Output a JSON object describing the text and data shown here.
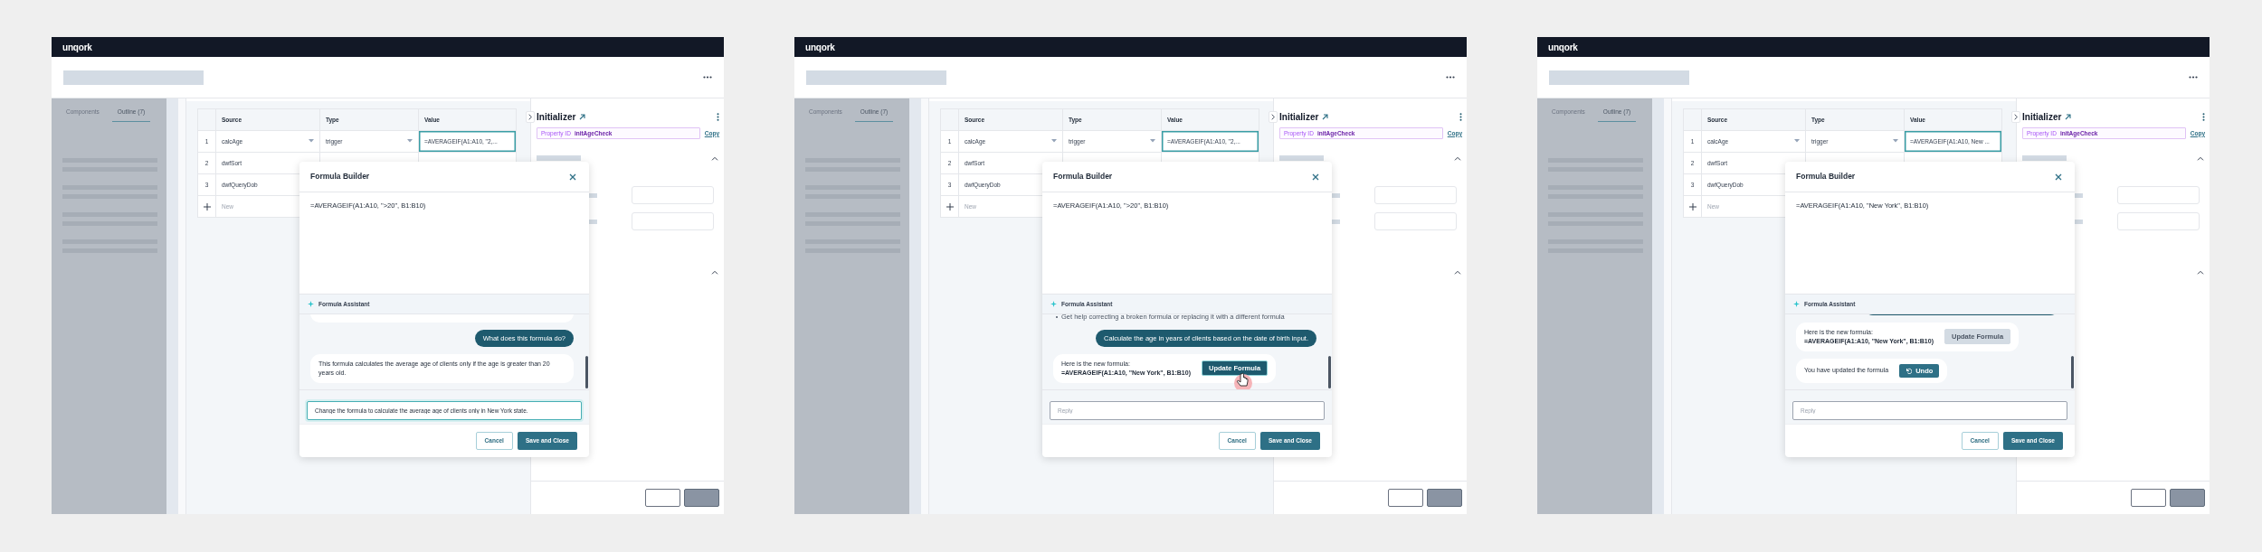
{
  "screens": [
    {
      "logo": "unqork",
      "sidebar_tabs": [
        {
          "label": "Components",
          "selected": false
        },
        {
          "label": "Outline (7)",
          "selected": true
        }
      ],
      "table": {
        "columns": [
          "Source",
          "Type",
          "Value"
        ],
        "rows": [
          {
            "number": "1",
            "source": "calcAge",
            "type": "trigger",
            "value": "=AVERAGEIF(A1:A10, \"2,...",
            "selected": true
          },
          {
            "number": "2",
            "source": "dwfSort",
            "selected": false
          },
          {
            "number": "3",
            "source": "dwfQueryDob"
          }
        ],
        "new_row": "New"
      },
      "inspector": {
        "title": "Initializer",
        "property_label": "Property ID",
        "property_id": "initAgeCheck",
        "copy": "Copy"
      },
      "formula_builder": {
        "title": "Formula Builder",
        "formula": "=AVERAGEIF(A1:A10, \">20\", B1:B10)",
        "assistant_title": "Formula Assistant",
        "messages": [
          {
            "kind": "clipped_assistant"
          },
          {
            "kind": "user",
            "text": "What does this formula do?"
          },
          {
            "kind": "assistant",
            "text": "This formula calculates the average age of clients only if the age is greater than 20 years old."
          }
        ],
        "reply": {
          "value": "Change the formula to calculate the average age of clients only in New York state.",
          "focused": true
        },
        "buttons": [
          {
            "label": "Cancel",
            "kind": "secondary"
          },
          {
            "label": "Save and Close",
            "kind": "primary"
          }
        ]
      }
    },
    {
      "logo": "unqork",
      "sidebar_tabs": [
        {
          "label": "Components",
          "selected": false
        },
        {
          "label": "Outline (7)",
          "selected": true
        }
      ],
      "table": {
        "columns": [
          "Source",
          "Type",
          "Value"
        ],
        "rows": [
          {
            "number": "1",
            "source": "calcAge",
            "type": "trigger",
            "value": "=AVERAGEIF(A1:A10, \"2,...",
            "selected": true
          },
          {
            "number": "2",
            "source": "dwfSort",
            "selected": false
          },
          {
            "number": "3",
            "source": "dwfQueryDob"
          }
        ],
        "new_row": "New"
      },
      "inspector": {
        "title": "Initializer",
        "property_label": "Property ID",
        "property_id": "initAgeCheck",
        "copy": "Copy"
      },
      "formula_builder": {
        "title": "Formula Builder",
        "formula": "=AVERAGEIF(A1:A10, \">20\", B1:B10)",
        "assistant_title": "Formula Assistant",
        "messages": [
          {
            "kind": "bullet",
            "text": "Get help correcting a broken formula or replacing it with a different formula"
          },
          {
            "kind": "user",
            "text": "Calculate the age in years of clients based on the date of birth input."
          },
          {
            "kind": "formula",
            "intro": "Here is the new formula:",
            "formula": "=AVERAGEIF(A1:A10, \"New York\", B1:B10)",
            "button": {
              "label": "Update Formula",
              "disabled": false
            },
            "pointer": true
          }
        ],
        "reply": {
          "placeholder": "Reply",
          "focused": false
        },
        "buttons": [
          {
            "label": "Cancel",
            "kind": "secondary"
          },
          {
            "label": "Save and Close",
            "kind": "primary"
          }
        ]
      }
    },
    {
      "logo": "unqork",
      "sidebar_tabs": [
        {
          "label": "Components",
          "selected": false
        },
        {
          "label": "Outline (7)",
          "selected": true
        }
      ],
      "table": {
        "columns": [
          "Source",
          "Type",
          "Value"
        ],
        "rows": [
          {
            "number": "1",
            "source": "calcAge",
            "type": "trigger",
            "value": "=AVERAGEIF(A1:A10, New ...",
            "selected": true
          },
          {
            "number": "2",
            "source": "dwfSort",
            "selected": false
          },
          {
            "number": "3",
            "source": "dwfQueryDob"
          }
        ],
        "new_row": "New"
      },
      "inspector": {
        "title": "Initializer",
        "property_label": "Property ID",
        "property_id": "initAgeCheck",
        "copy": "Copy"
      },
      "formula_builder": {
        "title": "Formula Builder",
        "formula": "=AVERAGEIF(A1:A10, \"New York\", B1:B10)",
        "assistant_title": "Formula Assistant",
        "messages": [
          {
            "kind": "clipped_user"
          },
          {
            "kind": "formula",
            "intro": "Here is the new formula:",
            "formula": "=AVERAGEIF(A1:A10, \"New York\", B1:B10)",
            "button": {
              "label": "Update Formula",
              "disabled": true
            },
            "pointer": false
          },
          {
            "kind": "action",
            "text": "You have updated the formula",
            "button": {
              "label": "Undo"
            }
          }
        ],
        "reply": {
          "placeholder": "Reply",
          "focused": false
        },
        "buttons": [
          {
            "label": "Cancel",
            "kind": "secondary"
          },
          {
            "label": "Save and Close",
            "kind": "primary"
          }
        ]
      }
    }
  ]
}
